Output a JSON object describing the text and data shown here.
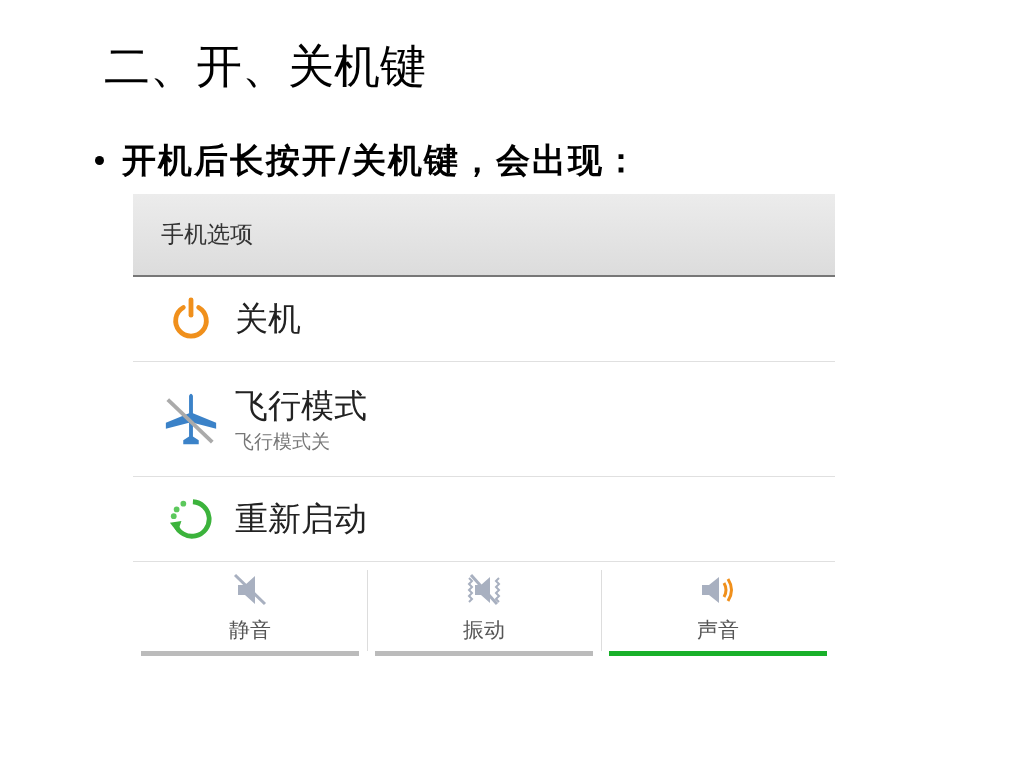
{
  "slide_title": "二、开、关机键",
  "bullet": "开机后长按开/关机键，会出现：",
  "dialog": {
    "title": "手机选项",
    "items": [
      {
        "kind": "power",
        "label": "关机"
      },
      {
        "kind": "airplane",
        "label": "飞行模式",
        "subtitle": "飞行模式关"
      },
      {
        "kind": "restart",
        "label": "重新启动"
      }
    ],
    "sound_modes": [
      {
        "kind": "silent",
        "label": "静音",
        "selected": false
      },
      {
        "kind": "vibrate",
        "label": "振动",
        "selected": false
      },
      {
        "kind": "sound",
        "label": "声音",
        "selected": true
      }
    ]
  }
}
